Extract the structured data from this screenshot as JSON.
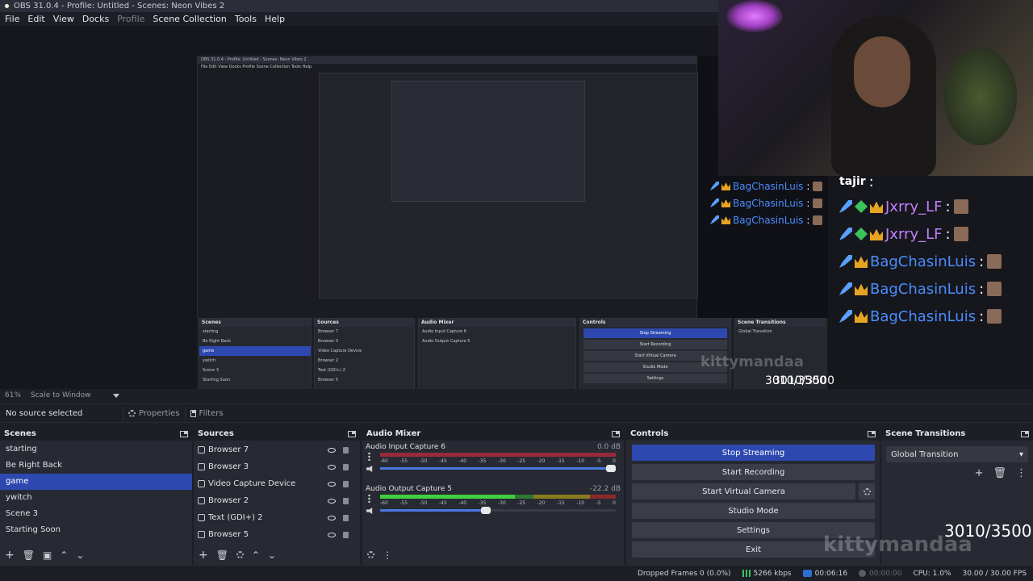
{
  "window": {
    "title": "OBS 31.0.4 - Profile: Untitled - Scenes: Neon Vibes 2"
  },
  "menu": {
    "items": [
      "File",
      "Edit",
      "View",
      "Docks",
      "Profile",
      "Scene Collection",
      "Tools",
      "Help"
    ]
  },
  "preview": {
    "zoom": "61%",
    "scale_mode": "Scale to Window",
    "counter": "3010/3500",
    "watermark": "kittymandaa"
  },
  "chat": {
    "top_user": "tajir",
    "lines": [
      {
        "user": "Jxrry_LF",
        "color": "purple"
      },
      {
        "user": "Jxrry_LF",
        "color": "purple"
      },
      {
        "user": "BagChasinLuis",
        "color": "blue"
      },
      {
        "user": "BagChasinLuis",
        "color": "blue"
      },
      {
        "user": "BagChasinLuis",
        "color": "blue"
      }
    ],
    "mid_user": "BagChasinLuis"
  },
  "properties_bar": {
    "no_source": "No source selected",
    "properties_label": "Properties",
    "filters_label": "Filters"
  },
  "scenes": {
    "title": "Scenes",
    "items": [
      "starting",
      "Be Right Back",
      "game",
      "ywitch",
      "Scene 3",
      "Starting Soon"
    ],
    "selected_index": 2
  },
  "sources": {
    "title": "Sources",
    "items": [
      "Browser 7",
      "Browser 3",
      "Video Capture Device",
      "Browser 2",
      "Text (GDI+) 2",
      "Browser 5"
    ]
  },
  "mixer": {
    "title": "Audio Mixer",
    "channels": [
      {
        "name": "Audio Input Capture 6",
        "db": "0.0 dB",
        "level": 0.0,
        "fader": 1.0
      },
      {
        "name": "Audio Output Capture 5",
        "db": "-22.2 dB",
        "level": 0.84,
        "fader": 0.45
      }
    ],
    "scale": [
      "-60",
      "-55",
      "-50",
      "-45",
      "-40",
      "-35",
      "-30",
      "-25",
      "-20",
      "-15",
      "-10",
      "-5",
      "0"
    ]
  },
  "controls": {
    "title": "Controls",
    "stop_streaming": "Stop Streaming",
    "start_recording": "Start Recording",
    "start_virtual_camera": "Start Virtual Camera",
    "studio_mode": "Studio Mode",
    "settings": "Settings",
    "exit": "Exit"
  },
  "transitions": {
    "title": "Scene Transitions",
    "selected": "Global Transition",
    "counter": "3010/3500"
  },
  "status": {
    "dropped_frames": "Dropped Frames 0 (0.0%)",
    "bitrate": "5266 kbps",
    "stream_time": "00:06:16",
    "rec_time": "00:00:00",
    "cpu": "CPU: 1.0%",
    "fps": "30.00 / 30.00 FPS"
  },
  "colors": {
    "accent": "#2d49b0",
    "panel": "#272a33",
    "bg": "#1d1f26"
  }
}
